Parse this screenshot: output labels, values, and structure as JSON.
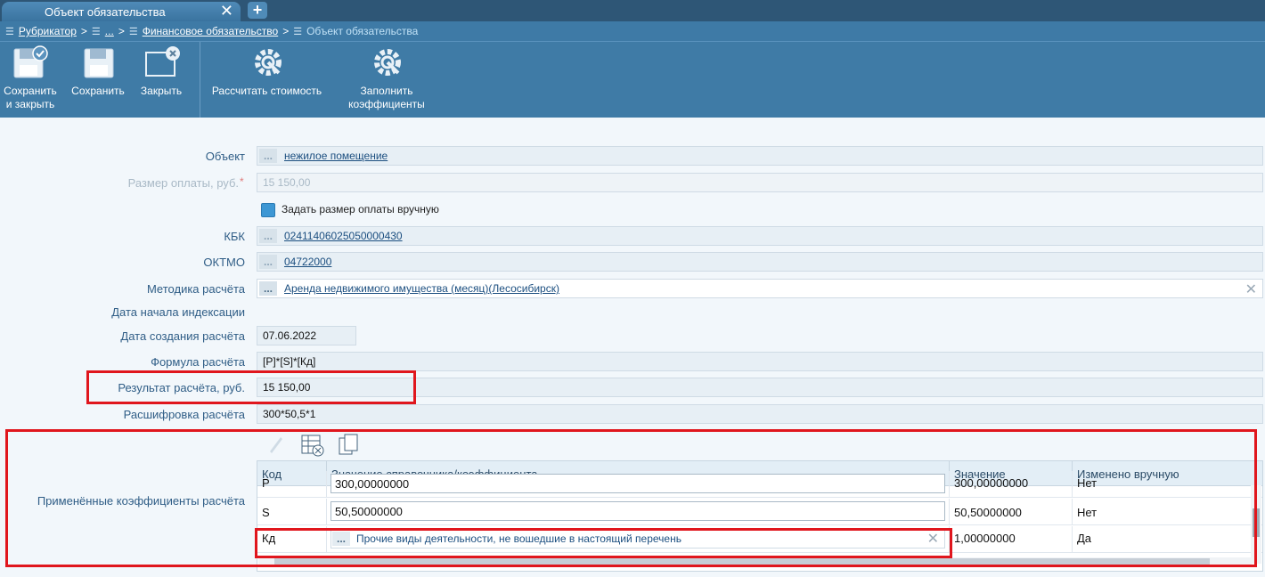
{
  "tab": {
    "title": "Объект обязательства",
    "add": "+",
    "close": "✕"
  },
  "breadcrumb": {
    "items": [
      "Рубрикатор",
      "...",
      "Финансовое обязательство"
    ],
    "current": "Объект обязательства",
    "sep": ">"
  },
  "toolbar": {
    "save_close": "Сохранить и закрыть",
    "save": "Сохранить",
    "close": "Закрыть",
    "calc": "Рассчитать стоимость",
    "fill": "Заполнить коэффициенты"
  },
  "form": {
    "object_label": "Объект",
    "object_value": "нежилое помещение",
    "payment_label": "Размер оплаты, руб.",
    "payment_required": "*",
    "payment_value": "15 150,00",
    "manual_label": "Задать размер оплаты вручную",
    "kbk_label": "КБК",
    "kbk_value": "02411406025050000430",
    "oktmo_label": "ОКТМО",
    "oktmo_value": "04722000",
    "method_label": "Методика расчёта",
    "method_value": "Аренда недвижимого имущества (месяц)(Лесосибирск)",
    "index_date_label": "Дата начала индексации",
    "created_label": "Дата создания расчёта",
    "created_value": "07.06.2022",
    "formula_label": "Формула расчёта",
    "formula_value": "[P]*[S]*[Кд]",
    "result_label": "Результат расчёта, руб.",
    "result_value": "15 150,00",
    "decode_label": "Расшифровка расчёта",
    "decode_value": "300*50,5*1",
    "coef_label": "Применённые коэффициенты расчёта",
    "dots": "..."
  },
  "grid": {
    "columns": [
      "Код",
      "Значение справочника/коэффициента",
      "Значение",
      "Изменено вручную"
    ],
    "rows": [
      {
        "code": "P",
        "ref": "300,00000000",
        "value": "300,00000000",
        "manual": "Нет"
      },
      {
        "code": "S",
        "ref": "50,50000000",
        "value": "50,50000000",
        "manual": "Нет"
      },
      {
        "code": "Кд",
        "ref": "Прочие виды деятельности, не вошедшие в настоящий перечень",
        "value": "1,00000000",
        "manual": "Да"
      }
    ]
  }
}
